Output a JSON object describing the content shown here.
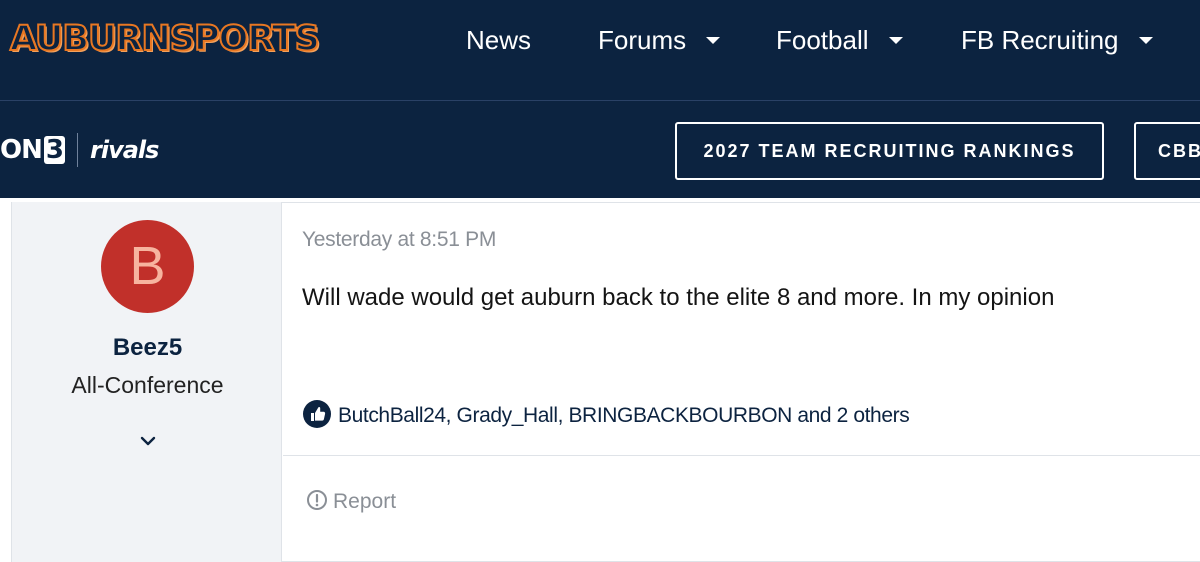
{
  "header": {
    "logo_text": "AUBURNSPORTS",
    "nav": [
      {
        "label": "News"
      },
      {
        "label": "Forums"
      },
      {
        "label": "Football"
      },
      {
        "label": "FB Recruiting"
      }
    ]
  },
  "subbar": {
    "on3_text": "ON",
    "on3_num": "3",
    "rivals_text": "rivals",
    "buttons": [
      {
        "label": "2027 TEAM RECRUITING RANKINGS"
      },
      {
        "label": "CBB"
      }
    ]
  },
  "post": {
    "author": {
      "avatar_letter": "B",
      "username": "Beez5",
      "title": "All-Conference"
    },
    "timestamp": "Yesterday at 8:51 PM",
    "message": "Will wade would get auburn back to the elite 8 and more. In my opinion",
    "reactions_text": "ButchBall24, Grady_Hall, BRINGBACKBOURBON and 2 others",
    "report_label": "Report"
  },
  "colors": {
    "navy": "#0c2340",
    "orange": "#e87722",
    "avatar_bg": "#c1302a",
    "avatar_fg": "#f7b49f",
    "muted": "#8a8f96",
    "user_col_bg": "#f1f3f6"
  },
  "icons": [
    "chevron-down-icon",
    "thumbs-up-icon",
    "alert-circle-icon"
  ]
}
